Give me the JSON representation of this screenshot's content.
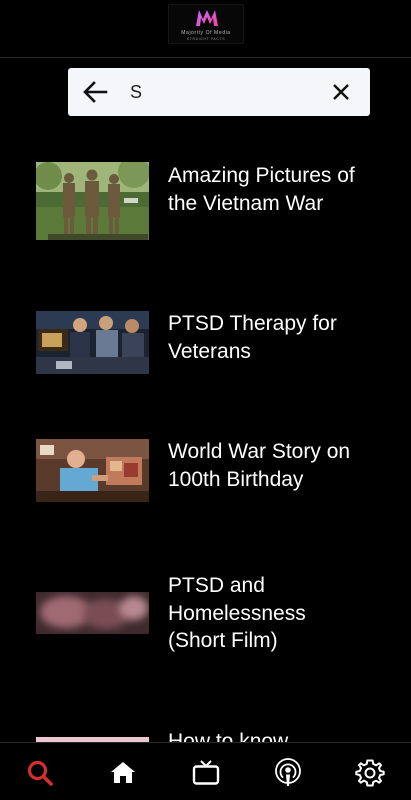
{
  "header": {
    "logo_text": "Majority Of Media",
    "logo_subtext": "STRAIGHT FACTS"
  },
  "search": {
    "query": "S",
    "back_icon": "arrow-left-icon",
    "clear_icon": "close-icon"
  },
  "results": [
    {
      "title": "Amazing Pictures of the Vietnam War",
      "thumbnail": "vietnam-memorial-statue-thumbnail"
    },
    {
      "title": "PTSD Therapy for Veterans",
      "thumbnail": "veterans-group-thumbnail"
    },
    {
      "title": "World War Story on 100th Birthday",
      "thumbnail": "veteran-birthday-thumbnail"
    },
    {
      "title": "PTSD and Homelessness (Short Film)",
      "thumbnail": "blurred-film-thumbnail"
    },
    {
      "title": "How to know",
      "thumbnail": "pink-thumbnail"
    }
  ],
  "bottom_nav": {
    "items": [
      {
        "icon": "search-icon",
        "active": true
      },
      {
        "icon": "home-icon",
        "active": false
      },
      {
        "icon": "tv-icon",
        "active": false
      },
      {
        "icon": "podcast-icon",
        "active": false
      },
      {
        "icon": "gear-icon",
        "active": false
      }
    ],
    "active_color": "#d32f2f",
    "inactive_color": "#ffffff"
  }
}
